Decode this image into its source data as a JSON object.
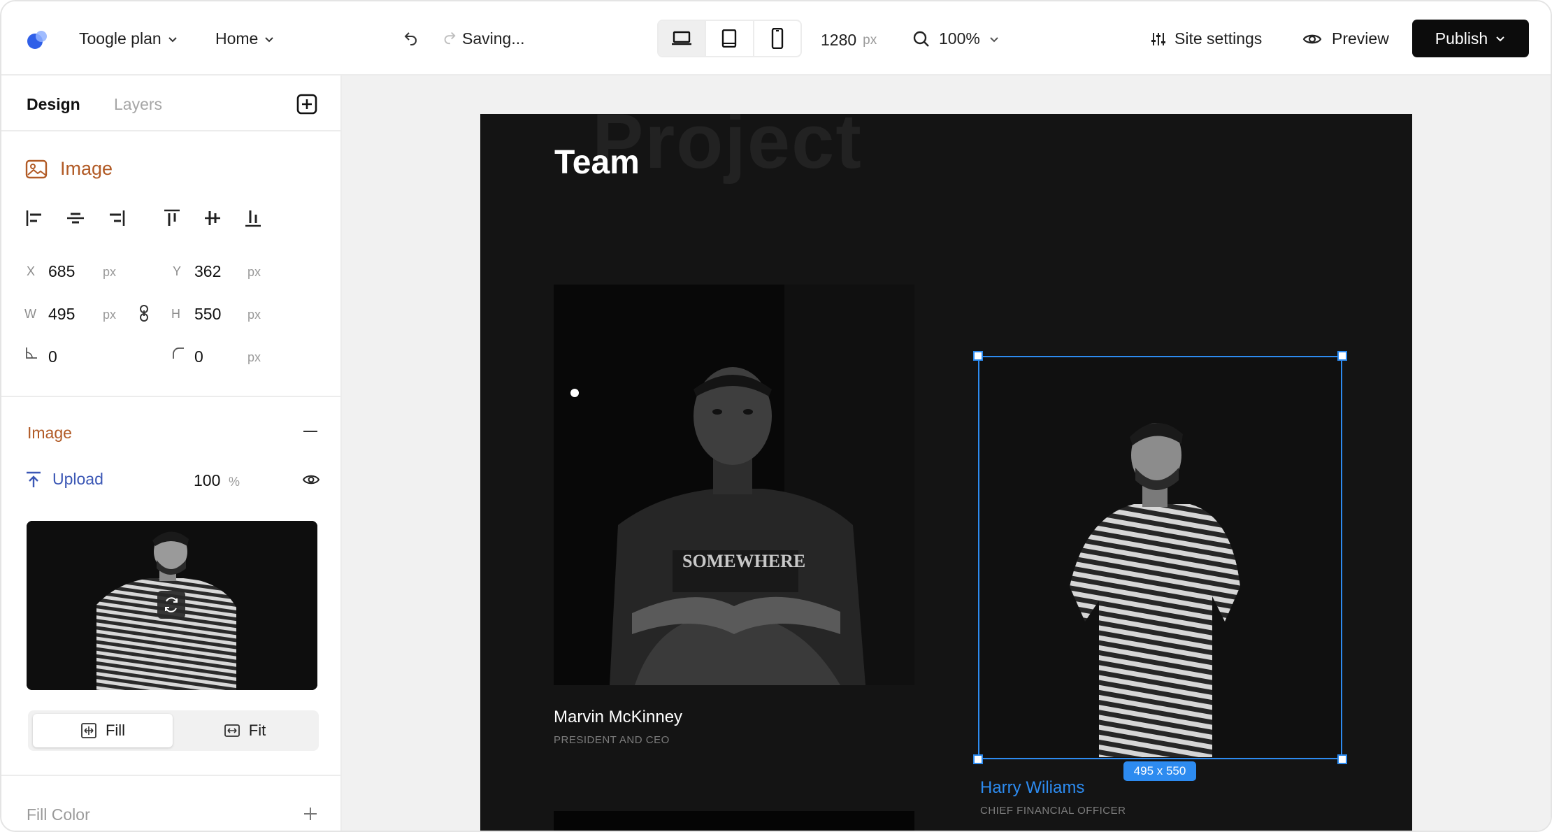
{
  "topbar": {
    "project": "Toogle plan",
    "page": "Home",
    "status": "Saving...",
    "width_value": "1280",
    "width_unit": "px",
    "zoom": "100%",
    "site_settings": "Site settings",
    "preview": "Preview",
    "publish": "Publish",
    "devices": [
      "desktop",
      "tablet",
      "mobile"
    ],
    "active_device": "desktop"
  },
  "panel": {
    "tabs": [
      "Design",
      "Layers"
    ],
    "active_tab": "Design",
    "element_type": "Image",
    "fields": {
      "x": {
        "label": "X",
        "value": "685",
        "unit": "px"
      },
      "y": {
        "label": "Y",
        "value": "362",
        "unit": "px"
      },
      "w": {
        "label": "W",
        "value": "495",
        "unit": "px"
      },
      "h": {
        "label": "H",
        "value": "550",
        "unit": "px"
      },
      "rotation": {
        "value": "0"
      },
      "radius": {
        "value": "0",
        "unit": "px"
      }
    },
    "image_section": {
      "title": "Image",
      "upload_label": "Upload",
      "opacity": "100",
      "opacity_unit": "%",
      "fill_label": "Fill",
      "fit_label": "Fit",
      "selected_mode": "Fill"
    },
    "fill_color_label": "Fill Color"
  },
  "canvas": {
    "watermark": "Project",
    "title": "Team",
    "members": [
      {
        "name": "Marvin McKinney",
        "role": "PRESIDENT AND CEO"
      },
      {
        "name": "Harry Wiliams",
        "role": "CHIEF FINANCIAL OFFICER"
      }
    ],
    "selection_size": "495 x 550"
  },
  "colors": {
    "accent_orange": "#b15a25",
    "selection_blue": "#2d8bf0",
    "upload_blue": "#3b57b5",
    "page_bg": "#141414",
    "publish_bg": "#0c0c0c"
  }
}
